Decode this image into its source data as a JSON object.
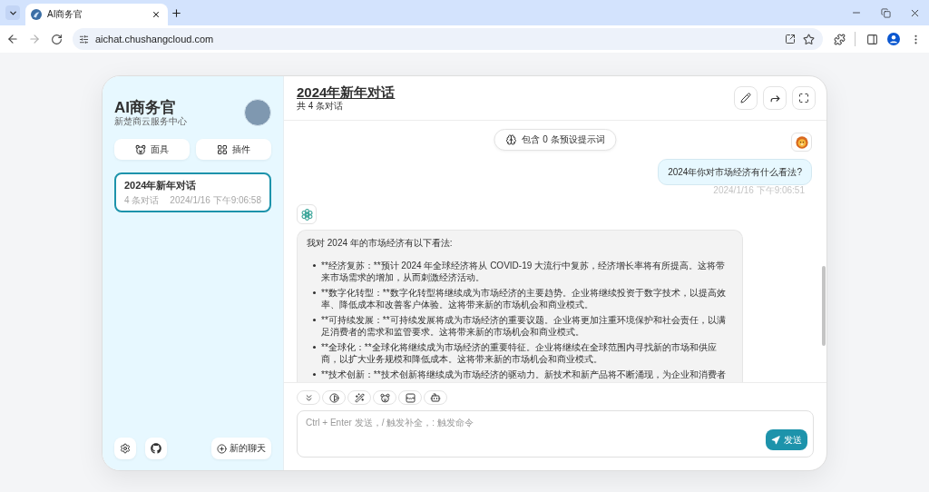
{
  "browser": {
    "tab_title": "AI商务官",
    "url": "aichat.chushangcloud.com"
  },
  "sidebar": {
    "title": "AI商务官",
    "subtitle": "新楚商云服务中心",
    "buttons": [
      {
        "kind": "mask",
        "label": "面具"
      },
      {
        "kind": "plugin",
        "label": "插件"
      }
    ],
    "chats": [
      {
        "title": "2024年新年对话",
        "count": "4 条对话",
        "time": "2024/1/16 下午9:06:58",
        "selected": true
      }
    ],
    "new_chat_button": "新的聊天"
  },
  "chat": {
    "title": "2024年新年对话",
    "subtitle": "共 4 条对话",
    "prompt_info": "包含 0 条预设提示词",
    "messages": [
      {
        "kind": "user",
        "text": "2024年你对市场经济有什么看法?",
        "time": "2024/1/16 下午9:06:51"
      },
      {
        "kind": "assistant",
        "text": "我对 2024 年的市场经济有以下看法:",
        "items": [
          "**经济复苏：**预计 2024 年全球经济将从 COVID-19 大流行中复苏，经济增长率将有所提高。这将带来市场需求的增加，从而刺激经济活动。",
          "**数字化转型：**数字化转型将继续成为市场经济的主要趋势。企业将继续投资于数字技术，以提高效率、降低成本和改善客户体验。这将带来新的市场机会和商业模式。",
          "**可持续发展：**可持续发展将成为市场经济的重要议题。企业将更加注重环境保护和社会责任，以满足消费者的需求和监管要求。这将带来新的市场机会和商业模式。",
          "**全球化：**全球化将继续成为市场经济的重要特征。企业将继续在全球范围内寻找新的市场和供应商，以扩大业务规模和降低成本。这将带来新的市场机会和商业模式。",
          "**技术创新：**技术创新将继续成为市场经济的驱动力。新技术和新产品将不断涌现，为企业和消费者"
        ]
      }
    ]
  },
  "composer": {
    "placeholder": "Ctrl + Enter 发送，/ 触发补全，: 触发命令",
    "send_button": "发送"
  }
}
